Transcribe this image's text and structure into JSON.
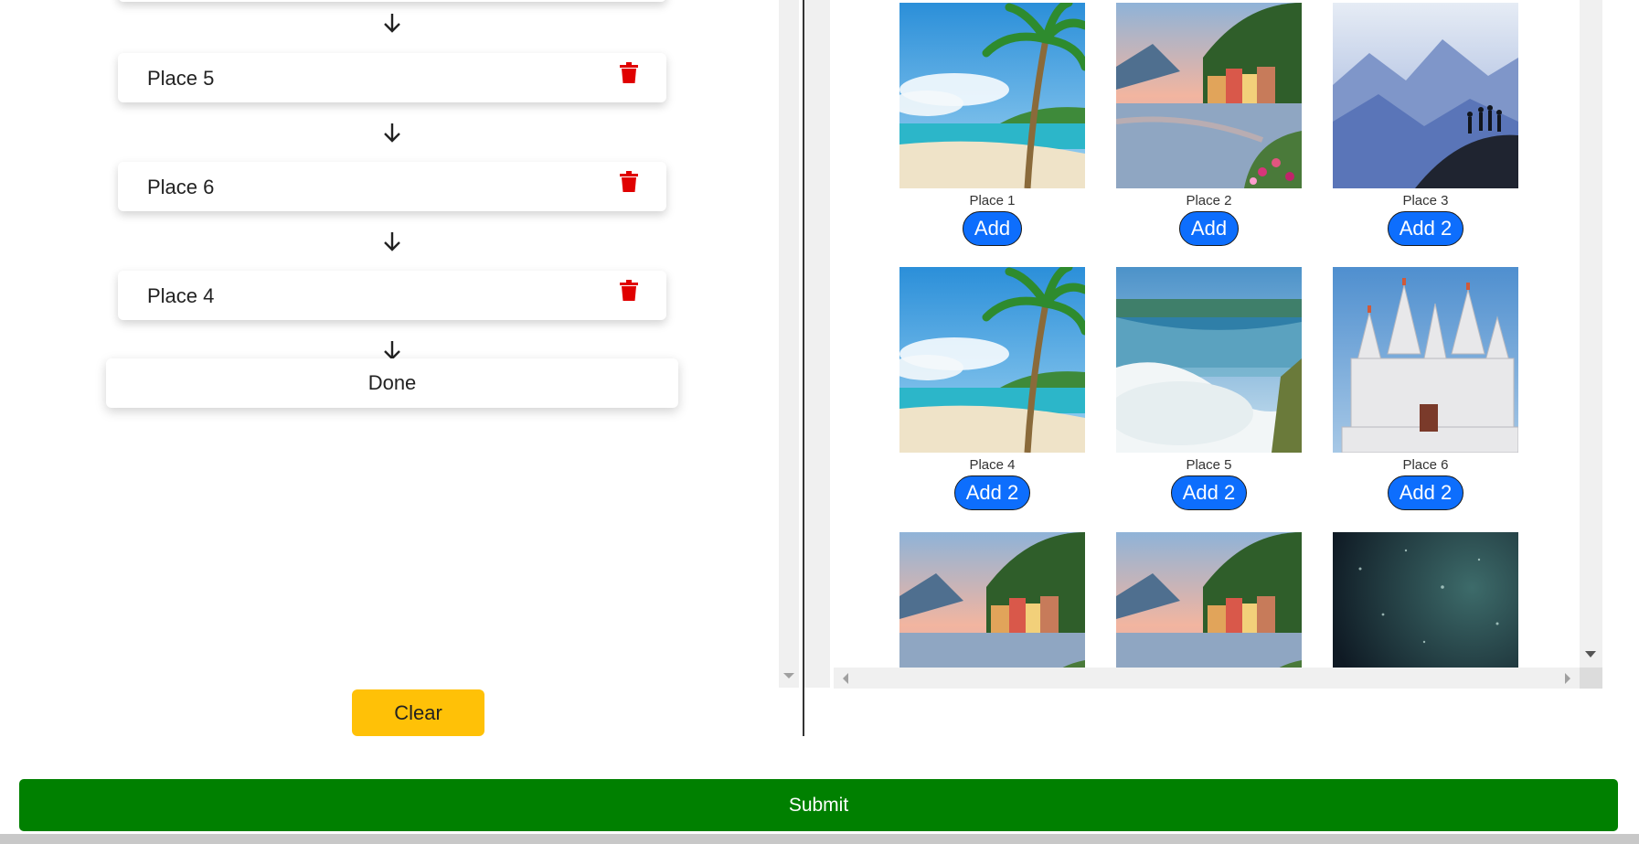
{
  "colors": {
    "add_button": "#0d6efd",
    "clear_button": "#ffc107",
    "submit_button": "#008000",
    "trash_icon": "#e00000"
  },
  "itinerary": {
    "stops": [
      {
        "label": "Place 5",
        "icon": "trash-icon"
      },
      {
        "label": "Place 6",
        "icon": "trash-icon"
      },
      {
        "label": "Place 4",
        "icon": "trash-icon"
      }
    ],
    "arrow_icon": "arrow-down-icon",
    "done_label": "Done",
    "clear_label": "Clear"
  },
  "gallery": {
    "places": [
      {
        "name": "Place 1",
        "button": "Add",
        "scene": "beach"
      },
      {
        "name": "Place 2",
        "button": "Add",
        "scene": "lake-town"
      },
      {
        "name": "Place 3",
        "button": "Add 2",
        "scene": "mountain-hikers"
      },
      {
        "name": "Place 4",
        "button": "Add 2",
        "scene": "beach"
      },
      {
        "name": "Place 5",
        "button": "Add 2",
        "scene": "waterfall"
      },
      {
        "name": "Place 6",
        "button": "Add 2",
        "scene": "temple"
      },
      {
        "name": "",
        "button": "",
        "scene": "lake-town"
      },
      {
        "name": "",
        "button": "",
        "scene": "lake-town"
      },
      {
        "name": "",
        "button": "",
        "scene": "night-sky"
      }
    ]
  },
  "submit_label": "Submit"
}
